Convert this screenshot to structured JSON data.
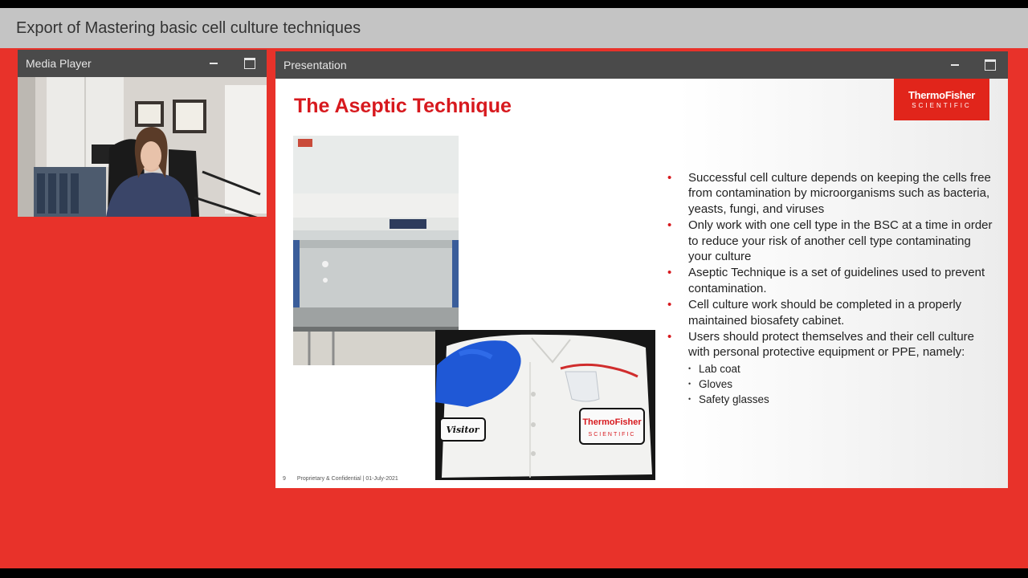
{
  "window": {
    "title": "Export of Mastering basic cell culture techniques"
  },
  "media_player": {
    "title": "Media Player",
    "minimize_icon": "minimize-icon",
    "maximize_icon": "maximize-icon"
  },
  "presentation": {
    "title": "Presentation",
    "minimize_icon": "minimize-icon",
    "maximize_icon": "maximize-icon",
    "slide": {
      "title": "The Aseptic Technique",
      "logo": {
        "line1": "ThermoFisher",
        "line2": "SCIENTIFIC"
      },
      "bullets": [
        "Successful cell culture depends on keeping the cells free from contamination by microorganisms such as bacteria, yeasts, fungi, and viruses",
        "Only work with one cell type in the BSC at a time in order to reduce your risk of another cell type contaminating your culture",
        "Aseptic Technique is a set of guidelines used to prevent contamination.",
        "Cell culture work should be completed in a properly maintained biosafety cabinet.",
        "Users should protect themselves and their cell culture with personal protective equipment or PPE, namely:"
      ],
      "sub_bullets": [
        "Lab coat",
        "Gloves",
        "Safety glasses"
      ],
      "coat_patch": {
        "name_tag": "Visitor",
        "brand1": "ThermoFisher",
        "brand2": "SCIENTIFIC"
      },
      "footer": {
        "page": "9",
        "text": "Proprietary & Confidential |  01-July-2021"
      }
    }
  },
  "colors": {
    "background": "#e8322a",
    "brand_red": "#d7191e",
    "header": "#4a4a4a",
    "titlebar": "#c4c4c4"
  }
}
